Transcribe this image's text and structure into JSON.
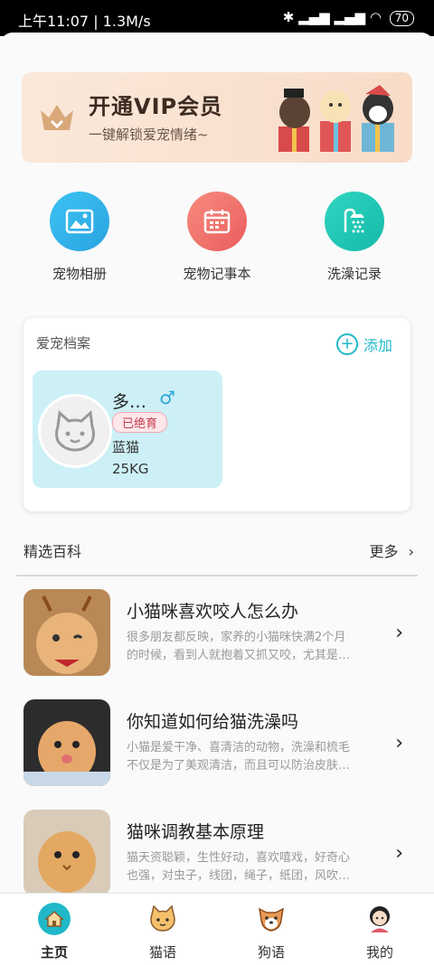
{
  "status_bar": {
    "time_speed": "上午11:07 | 1.3M/s",
    "battery": "70"
  },
  "vip_banner": {
    "title": "开通VIP会员",
    "subtitle": "一键解锁爱宠情绪~"
  },
  "quick_actions": [
    {
      "label": "宠物相册",
      "icon": "image-icon",
      "color": "#2fb4ea"
    },
    {
      "label": "宠物记事本",
      "icon": "calendar-icon",
      "color": "#f06a6a"
    },
    {
      "label": "洗澡记录",
      "icon": "shower-icon",
      "color": "#1ec9b7"
    }
  ],
  "pet_profile": {
    "title": "爱宠档案",
    "add_label": "添加",
    "pet": {
      "name": "多…",
      "gender": "♂",
      "badge": "已绝育",
      "breed": "蓝猫",
      "weight": "25KG"
    }
  },
  "encyclopedia": {
    "title": "精选百科",
    "more_label": "更多"
  },
  "articles": [
    {
      "title": "小猫咪喜欢咬人怎么办",
      "desc": "很多朋友都反映，家养的小猫咪快满2个月\n的时候，看到人就抱着又抓又咬，尤其是…"
    },
    {
      "title": "你知道如何给猫洗澡吗",
      "desc": "小猫是爱干净、喜清洁的动物，洗澡和梳毛\n不仅是为了美观清洁，而且可以防治皮肤…"
    },
    {
      "title": "猫咪调教基本原理",
      "desc": "猫天资聪颖，生性好动，喜欢嘻戏，好奇心\n也强，对虫子，线团，绳子，纸团，风吹…"
    }
  ],
  "tabs": [
    {
      "label": "主页",
      "active": true
    },
    {
      "label": "猫语",
      "active": false
    },
    {
      "label": "狗语",
      "active": false
    },
    {
      "label": "我的",
      "active": false
    }
  ],
  "colors": {
    "accent": "#20b8c8",
    "pet_card_bg": "#cdf0f7"
  }
}
